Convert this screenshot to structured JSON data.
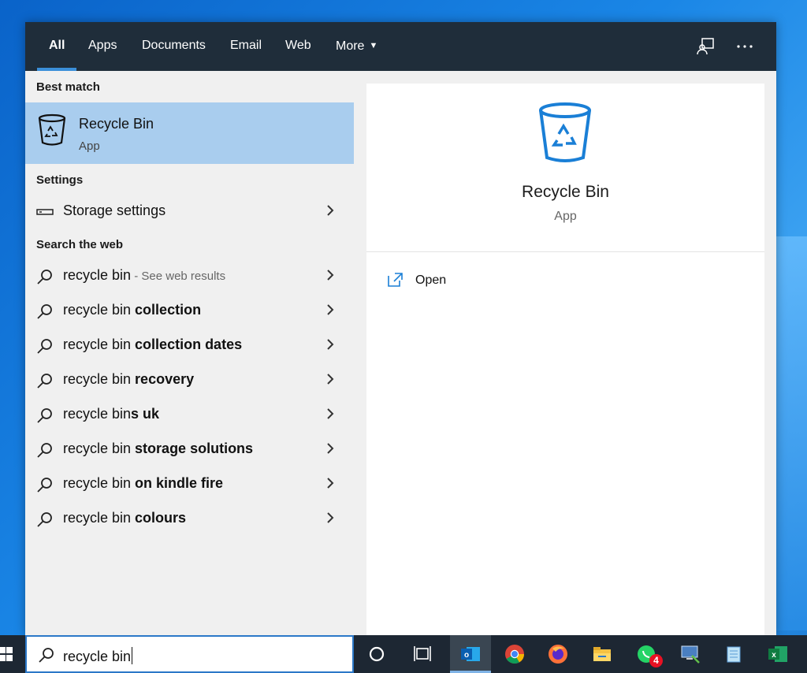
{
  "tabs": [
    {
      "label": "All",
      "active": true
    },
    {
      "label": "Apps"
    },
    {
      "label": "Documents"
    },
    {
      "label": "Email"
    },
    {
      "label": "Web"
    },
    {
      "label": "More"
    }
  ],
  "toolbar_icons": [
    "feedback-icon",
    "more-options-icon"
  ],
  "sections": {
    "best_match": "Best match",
    "settings": "Settings",
    "search_web": "Search the web"
  },
  "best_match": {
    "title": "Recycle Bin",
    "subtitle": "App",
    "icon": "recycle-bin-icon"
  },
  "settings_items": [
    {
      "label": "Storage settings",
      "icon": "storage-icon"
    }
  ],
  "web_results": [
    {
      "prefix": "recycle bin",
      "bold": "",
      "hint": " - See web results"
    },
    {
      "prefix": "recycle bin ",
      "bold": "collection",
      "hint": ""
    },
    {
      "prefix": "recycle bin ",
      "bold": "collection dates",
      "hint": ""
    },
    {
      "prefix": "recycle bin ",
      "bold": "recovery",
      "hint": ""
    },
    {
      "prefix": "recycle bin",
      "bold": "s uk",
      "hint": ""
    },
    {
      "prefix": "recycle bin ",
      "bold": "storage solutions",
      "hint": ""
    },
    {
      "prefix": "recycle bin ",
      "bold": "on kindle fire",
      "hint": ""
    },
    {
      "prefix": "recycle bin ",
      "bold": "colours",
      "hint": ""
    }
  ],
  "preview": {
    "title": "Recycle Bin",
    "subtitle": "App",
    "action": "Open"
  },
  "search": {
    "value": "recycle bin"
  },
  "taskbar_apps": [
    {
      "name": "cortana-icon"
    },
    {
      "name": "task-view-icon"
    },
    {
      "name": "outlook-icon",
      "active": true
    },
    {
      "name": "chrome-icon"
    },
    {
      "name": "firefox-icon"
    },
    {
      "name": "file-explorer-icon"
    },
    {
      "name": "whatsapp-icon",
      "badge": "4"
    },
    {
      "name": "remote-desktop-icon"
    },
    {
      "name": "notepad-icon"
    },
    {
      "name": "excel-icon"
    }
  ],
  "colors": {
    "tabbar": "#1f2d3a",
    "accent": "#3b8fd9",
    "selection": "#a9cdee",
    "taskbar": "#1d2733"
  }
}
